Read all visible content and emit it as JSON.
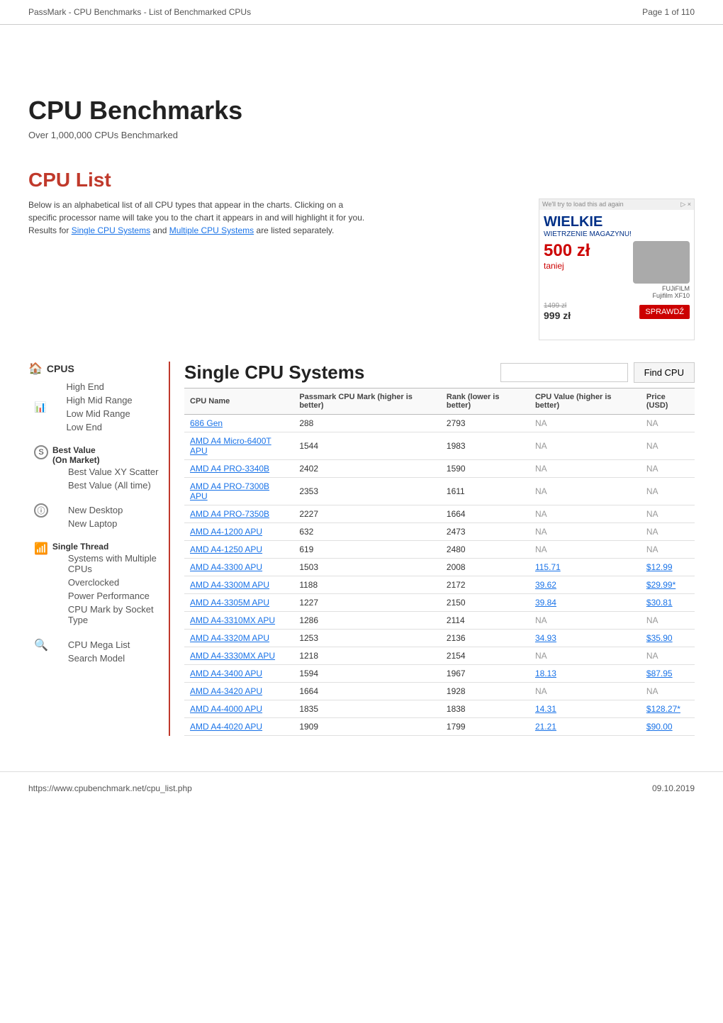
{
  "pageHeader": {
    "title": "PassMark - CPU Benchmarks - List of Benchmarked CPUs",
    "pagination": "Page 1 of 110"
  },
  "hero": {
    "title": "CPU Benchmarks",
    "subtitle": "Over 1,000,000 CPUs Benchmarked"
  },
  "cpuList": {
    "sectionTitle": "CPU List",
    "description": "Below is an alphabetical list of all CPU types that appear in the charts. Clicking on a specific processor name will take you to the chart it appears in and will highlight it for you. Results for",
    "link1": "Single CPU Systems",
    "and": "and",
    "link2": "Multiple CPU Systems",
    "descEnd": "are listed separately."
  },
  "sidebar": {
    "cpusHeader": "CPUS",
    "cpusIcon": "🏠",
    "chartIcon": "📊",
    "items": [
      {
        "label": "High End",
        "id": "high-end"
      },
      {
        "label": "High Mid Range",
        "id": "high-mid"
      },
      {
        "label": "Low Mid Range",
        "id": "low-mid"
      },
      {
        "label": "Low End",
        "id": "low-end"
      }
    ],
    "bestValueHeader": "Best Value\n(On Market)",
    "bestValueIcon": "S",
    "bestValueItems": [
      {
        "label": "Best Value XY Scatter",
        "id": "bv-xy"
      },
      {
        "label": "Best Value (All time)",
        "id": "bv-all"
      }
    ],
    "newIcon": "ⓘ",
    "newItems": [
      {
        "label": "New Desktop",
        "id": "new-desktop"
      },
      {
        "label": "New Laptop",
        "id": "new-laptop"
      }
    ],
    "singleThreadIcon": "📶",
    "singleThread": "Single Thread",
    "singleThreadItems": [
      {
        "label": "Systems with Multiple CPUs",
        "id": "multi-cpu"
      },
      {
        "label": "Overclocked",
        "id": "overclocked"
      },
      {
        "label": "Power Performance",
        "id": "power-perf"
      },
      {
        "label": "CPU Mark by Socket Type",
        "id": "socket-type"
      }
    ],
    "searchIcon": "🔍",
    "searchItems": [
      {
        "label": "CPU Mega List",
        "id": "mega-list"
      },
      {
        "label": "Search Model",
        "id": "search-model"
      }
    ]
  },
  "mainTable": {
    "title": "Single CPU Systems",
    "findCpuBtn": "Find CPU",
    "columns": {
      "cpuName": "CPU Name",
      "passMark": "Passmark CPU Mark (higher is better)",
      "rank": "Rank (lower is better)",
      "cpuValue": "CPU Value (higher is better)",
      "price": "Price (USD)"
    },
    "rows": [
      {
        "name": "686 Gen",
        "mark": "288",
        "rank": "2793",
        "value": "NA",
        "price": "NA"
      },
      {
        "name": "AMD A4 Micro-6400T APU",
        "mark": "1544",
        "rank": "1983",
        "value": "NA",
        "price": "NA"
      },
      {
        "name": "AMD A4 PRO-3340B",
        "mark": "2402",
        "rank": "1590",
        "value": "NA",
        "price": "NA"
      },
      {
        "name": "AMD A4 PRO-7300B APU",
        "mark": "2353",
        "rank": "1611",
        "value": "NA",
        "price": "NA"
      },
      {
        "name": "AMD A4 PRO-7350B",
        "mark": "2227",
        "rank": "1664",
        "value": "NA",
        "price": "NA"
      },
      {
        "name": "AMD A4-1200 APU",
        "mark": "632",
        "rank": "2473",
        "value": "NA",
        "price": "NA"
      },
      {
        "name": "AMD A4-1250 APU",
        "mark": "619",
        "rank": "2480",
        "value": "NA",
        "price": "NA"
      },
      {
        "name": "AMD A4-3300 APU",
        "mark": "1503",
        "rank": "2008",
        "value": "115.71",
        "price": "$12.99"
      },
      {
        "name": "AMD A4-3300M APU",
        "mark": "1188",
        "rank": "2172",
        "value": "39.62",
        "price": "$29.99*"
      },
      {
        "name": "AMD A4-3305M APU",
        "mark": "1227",
        "rank": "2150",
        "value": "39.84",
        "price": "$30.81"
      },
      {
        "name": "AMD A4-3310MX APU",
        "mark": "1286",
        "rank": "2114",
        "value": "NA",
        "price": "NA"
      },
      {
        "name": "AMD A4-3320M APU",
        "mark": "1253",
        "rank": "2136",
        "value": "34.93",
        "price": "$35.90"
      },
      {
        "name": "AMD A4-3330MX APU",
        "mark": "1218",
        "rank": "2154",
        "value": "NA",
        "price": "NA"
      },
      {
        "name": "AMD A4-3400 APU",
        "mark": "1594",
        "rank": "1967",
        "value": "18.13",
        "price": "$87.95"
      },
      {
        "name": "AMD A4-3420 APU",
        "mark": "1664",
        "rank": "1928",
        "value": "NA",
        "price": "NA"
      },
      {
        "name": "AMD A4-4000 APU",
        "mark": "1835",
        "rank": "1838",
        "value": "14.31",
        "price": "$128.27*"
      },
      {
        "name": "AMD A4-4020 APU",
        "mark": "1909",
        "rank": "1799",
        "value": "21.21",
        "price": "$90.00"
      }
    ]
  },
  "footer": {
    "url": "https://www.cpubenchmark.net/cpu_list.php",
    "date": "09.10.2019"
  },
  "ad": {
    "dismiss": "▷ ×",
    "tryAgain": "We'll try to load this ad again",
    "brand": "WIELKIE",
    "subtitle": "WIETRZENIE MAGAZYNU!",
    "price": "500 zł",
    "priceSub": "taniej",
    "oldPrice": "1499 zł",
    "newPrice": "999 zł",
    "btnLabel": "SPRAWDŹ",
    "fujiLabel": "FUJiFILM",
    "fujiModel": "Fujifilm XF10"
  }
}
